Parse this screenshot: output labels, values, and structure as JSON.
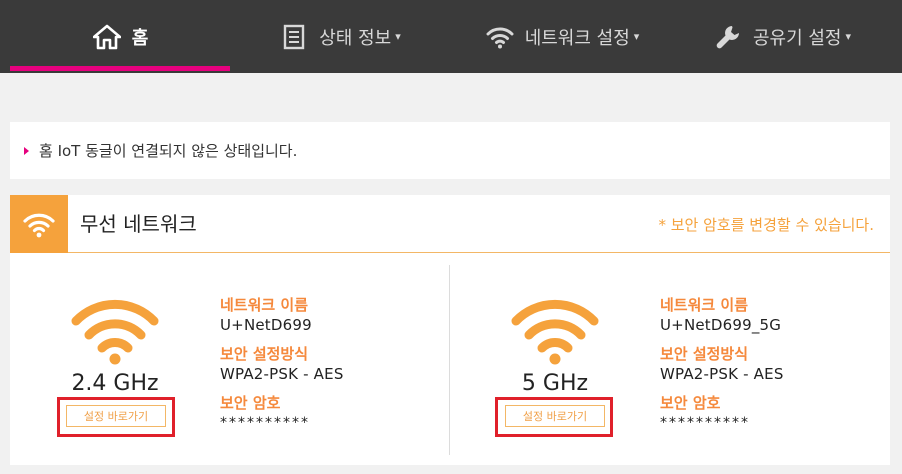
{
  "nav": {
    "items": [
      {
        "label": "홈",
        "icon": "home-icon",
        "has_caret": false,
        "active": true
      },
      {
        "label": "상태 정보",
        "icon": "document-icon",
        "has_caret": true,
        "active": false
      },
      {
        "label": "네트워크 설정",
        "icon": "wifi-icon",
        "has_caret": true,
        "active": false
      },
      {
        "label": "공유기 설정",
        "icon": "wrench-icon",
        "has_caret": true,
        "active": false
      }
    ],
    "caret": "▾"
  },
  "notice": {
    "text": "홈 IoT 동글이 연결되지 않은 상태입니다."
  },
  "wireless": {
    "title": "무선 네트워크",
    "note": "* 보안 암호를 변경할 수 있습니다.",
    "bands": [
      {
        "freq": "2.4 GHz",
        "button": "설정 바로가기",
        "network_name_label": "네트워크 이름",
        "network_name": "U+NetD699",
        "security_method_label": "보안 설정방식",
        "security_method": "WPA2-PSK - AES",
        "password_label": "보안 암호",
        "password": "**********"
      },
      {
        "freq": "5 GHz",
        "button": "설정 바로가기",
        "network_name_label": "네트워크 이름",
        "network_name": "U+NetD699_5G",
        "security_method_label": "보안 설정방식",
        "security_method": "WPA2-PSK - AES",
        "password_label": "보안 암호",
        "password": "**********"
      }
    ]
  },
  "colors": {
    "nav_bg": "#3a3a3a",
    "accent_pink": "#e6007e",
    "accent_orange": "#f5a23c",
    "label_orange": "#f5893c",
    "highlight_red": "#e0202a"
  }
}
